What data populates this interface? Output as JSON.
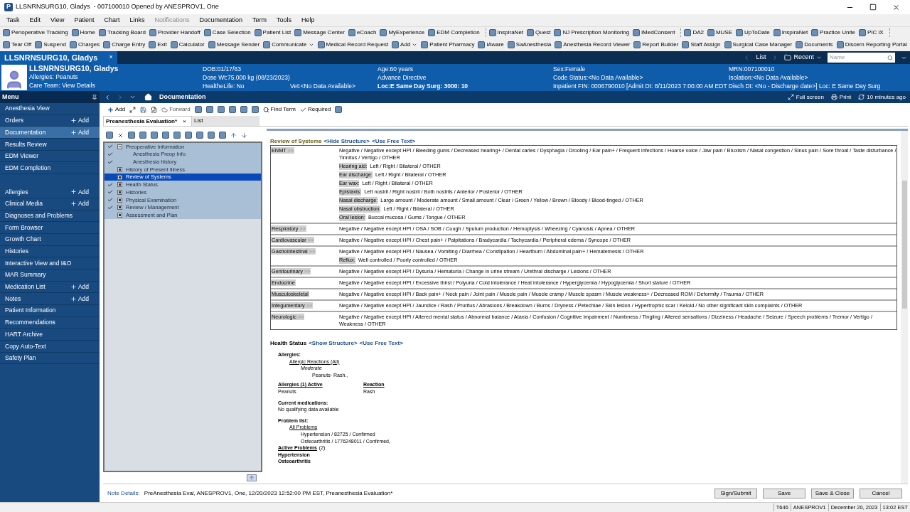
{
  "window": {
    "app_letter": "P",
    "title": "LLSNRNSURG10, Gladys  - 007100010 Opened by ANESPROV1, One"
  },
  "menubar": [
    {
      "label": "Task",
      "disabled": false
    },
    {
      "label": "Edit",
      "disabled": false
    },
    {
      "label": "View",
      "disabled": false
    },
    {
      "label": "Patient",
      "disabled": false
    },
    {
      "label": "Chart",
      "disabled": false
    },
    {
      "label": "Links",
      "disabled": false
    },
    {
      "label": "Notifications",
      "disabled": true
    },
    {
      "label": "Documentation",
      "disabled": false
    },
    {
      "label": "Term",
      "disabled": false
    },
    {
      "label": "Tools",
      "disabled": false
    },
    {
      "label": "Help",
      "disabled": false
    }
  ],
  "toolbar_1": [
    [
      "Perioperative Tracking",
      "Home",
      "Tracking Board",
      "Provider Handoff",
      "Case Selection",
      "Patient List",
      "Message Center",
      "eCoach",
      "MyExperience",
      "EDM Completion"
    ],
    [
      "InspiraNet",
      "Quest",
      "NJ Prescription Monitoring",
      "iMedConsent"
    ],
    [
      "DA2",
      "MUSE",
      "UpToDate",
      "InspiraNet",
      "Practice Unite",
      "PIC iX"
    ]
  ],
  "toolbar_2": [
    {
      "label": "Tear Off",
      "dropdown": false
    },
    {
      "label": "Suspend",
      "dropdown": false
    },
    {
      "label": "Charges",
      "dropdown": false
    },
    {
      "label": "Charge Entry",
      "dropdown": false
    },
    {
      "label": "Exit",
      "dropdown": false
    },
    {
      "label": "Calculator",
      "dropdown": false
    },
    {
      "label": "Message Sender",
      "dropdown": false
    },
    {
      "label": "Communicate",
      "dropdown": true
    },
    {
      "label": "Medical Record Request",
      "dropdown": false
    },
    {
      "label": "Add",
      "dropdown": true
    },
    {
      "label": "Patient Pharmacy",
      "dropdown": false
    },
    {
      "label": "iAware",
      "dropdown": false
    },
    {
      "label": "SaAnesthesia",
      "dropdown": false
    },
    {
      "label": "Anesthesia Record Viewer",
      "dropdown": false
    },
    {
      "label": "Report Builder",
      "dropdown": false
    },
    {
      "label": "Staff Assign",
      "dropdown": false
    },
    {
      "label": "Surgical Case Manager",
      "dropdown": false
    },
    {
      "label": "Documents",
      "dropdown": false
    },
    {
      "label": "Discern Reporting Portal",
      "dropdown": false
    }
  ],
  "patient_tab": {
    "label": "LLSNRNSURG10, Gladys",
    "close": "×"
  },
  "patient_nav": {
    "list": "List",
    "recent": "Recent",
    "search_placeholder": "Name"
  },
  "banner": {
    "name": "LLSNRNSURG10, Gladys",
    "allergies": "Allergies: Peanuts",
    "care_team": "Care Team: View Details",
    "dob": "DOB:01/17/63",
    "dose_wt": "Dose Wt:75.000 kg (08/23/2023)",
    "healthelife": "HealtheLife: No",
    "vet": "Vet:<No Data Available>",
    "age": "Age:60 years",
    "advance_directive": "Advance Directive",
    "loc": "Loc:E Same Day Surg: 3000: 10",
    "sex": "Sex:Female",
    "code_status": "Code Status:<No Data Available>",
    "fin": "Inpatient FIN: 0006790010 [Admit Dt: 8/11/2023 7:00:00 AM EDT Disch Dt: <No - Discharge date>] Loc: E Same Day Surg",
    "mrn": "MRN:007100010",
    "isolation": "Isolation:<No Data Available>"
  },
  "menu_bar": {
    "menu": "Menu",
    "page_title": "Documentation",
    "full_screen": "Full screen",
    "print": "Print",
    "refreshed": "10 minutes ago"
  },
  "sidebar": [
    [
      {
        "label": "Anesthesia View",
        "selected": false
      },
      {
        "label": "Orders",
        "add": "Add",
        "selected": false
      },
      {
        "label": "Documentation",
        "add": "Add",
        "selected": true
      },
      {
        "label": "Results Review",
        "selected": false
      },
      {
        "label": "EDM Viewer",
        "selected": false
      },
      {
        "label": "EDM Completion",
        "selected": false
      }
    ],
    [
      {
        "label": "Allergies",
        "add": "Add",
        "selected": false
      },
      {
        "label": "Clinical Media",
        "add": "Add",
        "selected": false
      },
      {
        "label": "Diagnoses and Problems",
        "selected": false
      },
      {
        "label": "Form Browser",
        "selected": false
      },
      {
        "label": "Growth Chart",
        "selected": false
      },
      {
        "label": "Histories",
        "selected": false
      },
      {
        "label": "Interactive View and I&O",
        "selected": false
      },
      {
        "label": "MAR Summary",
        "selected": false
      },
      {
        "label": "Medication List",
        "add": "Add",
        "selected": false
      },
      {
        "label": "Notes",
        "add": "Add",
        "selected": false
      },
      {
        "label": "Patient Information",
        "selected": false
      },
      {
        "label": "Recommendations",
        "selected": false
      },
      {
        "label": "HART Archive",
        "selected": false
      },
      {
        "label": "Copy Auto-Text",
        "selected": false
      },
      {
        "label": "Safety Plan",
        "selected": false
      }
    ]
  ],
  "doc_toolbar": {
    "add": "Add",
    "forward": "Forward",
    "find_term": "Find Term",
    "required": "Required"
  },
  "doc_tabs": [
    {
      "label": "Preanesthesia Evaluation*",
      "selected": true,
      "close": "×"
    },
    {
      "label": "List",
      "selected": false
    }
  ],
  "tree": [
    {
      "label": "Preoperative Information",
      "checked": true,
      "selected": false,
      "expanded": true,
      "children": [
        {
          "label": "Anesthesia Preop Info",
          "checked": true,
          "selected": false
        },
        {
          "label": "Anesthesia history",
          "checked": true,
          "selected": false
        }
      ]
    },
    {
      "label": "History of Present Illness",
      "checked": false,
      "selected": false,
      "expanded": false
    },
    {
      "label": "Review of Systems",
      "checked": false,
      "selected": true,
      "expanded": false
    },
    {
      "label": "Health Status",
      "checked": true,
      "selected": false,
      "expanded": false
    },
    {
      "label": "Histories",
      "checked": true,
      "selected": false,
      "expanded": false
    },
    {
      "label": "Physical Examination",
      "checked": true,
      "selected": false,
      "expanded": false
    },
    {
      "label": "Review / Management",
      "checked": true,
      "selected": false,
      "expanded": false
    },
    {
      "label": "Assessment and Plan",
      "checked": false,
      "selected": false,
      "expanded": false
    }
  ],
  "ros": {
    "title": "Review of Systems",
    "links": [
      "<Hide Structure>",
      "<Use Free Text>"
    ],
    "rows": [
      {
        "label": "ENMT",
        "more": ">>",
        "options": "Negative / Negative except HPI / Bleeding gums / Decreased hearing+ / Dental caries / Dysphagia / Drooling / Ear pain+ / Frequent infections / Hoarse voice / Jaw pain / Bruxism / Nasal congestion / Sinus pain / Sore throat / Taste disturbance / Tinnitus / Vertigo / OTHER",
        "sub": [
          {
            "label": "Hearing aid:",
            "options": "Left / Right / Bilateral / OTHER"
          },
          {
            "label": "Ear discharge:",
            "options": "Left / Right / Bilateral / OTHER"
          },
          {
            "label": "Ear wax:",
            "options": "Left / Right / Bilateral / OTHER"
          },
          {
            "label": "Epistaxis:",
            "options": "Left nostril / Right nostril / Both nostrils / Anterior / Posterior / OTHER"
          },
          {
            "label": "Nasal discharge:",
            "options": "Large amount / Moderate amount / Small amount / Clear / Green / Yellow / Brown / Bloody / Blood-tinged / OTHER"
          },
          {
            "label": "Nasal obstruction:",
            "options": "Left / Right / Bilateral / OTHER"
          },
          {
            "label": "Oral lesion:",
            "options": "Buccal mucosa / Gums / Tongue / OTHER"
          }
        ]
      },
      {
        "label": "Respiratory",
        "more": ">>",
        "options": "Negative / Negative except HPI / OSA / SOB / Cough / Sputum production / Hemoptysis / Wheezing / Cyanosis / Apnea / OTHER"
      },
      {
        "label": "Cardiovascular",
        "more": ">>",
        "options": "Negative / Negative except HPI / Chest pain+ / Palpitations / Bradycardia / Tachycardia / Peripheral edema / Syncope / OTHER"
      },
      {
        "label": "Gastrointestinal",
        "more": ">>",
        "options": "Negative / Negative except HPI / Nausea / Vomiting / Diarrhea / Constipation / Heartburn / Abdominal pain+ / Hematemesis / OTHER",
        "sub": [
          {
            "label": "Reflux:",
            "options": "Well controlled / Poorly controlled / OTHER"
          }
        ]
      },
      {
        "label": "Genitourinary",
        "more": ">>",
        "options": "Negative / Negative except HPI / Dysuria / Hematuria / Change in urine stream / Urethral discharge / Lesions / OTHER"
      },
      {
        "label": "Endocrine",
        "options": "Negative / Negative except HPI / Excessive thirst / Polyuria / Cold intolerance / Heat intolerance / Hyperglycemia / Hypoglycemia / Short stature / OTHER"
      },
      {
        "label": "Musculoskeletal",
        "options": "Negative / Negative except HPI / Back pain+ / Neck pain / Joint pain / Muscle pain / Muscle cramp / Muscle spasm / Muscle weakness+ / Decreased ROM / Deformity / Trauma / OTHER"
      },
      {
        "label": "Integumentary",
        "more": ">>",
        "options": "Negative / Negative except HPI / Jaundice / Rash / Pruritus / Abrasions / Breakdown / Burns / Dryness / Petechiae / Skin lesion / Hypertrophic scar / Keloid / No other significant skin complaints / OTHER"
      },
      {
        "label": "Neurologic",
        "more": ">>",
        "options": "Negative / Negative except HPI / Altered mental status / Abnormal balance / Ataxia / Confusion / Cognitive impairment / Numbness / Tingling / Altered sensations / Dizziness / Headache / Seizure / Speech problems / Tremor / Vertigo / Weakness / OTHER"
      }
    ]
  },
  "health_status": {
    "title": "Health Status",
    "links": [
      "<Show Structure>",
      "<Use Free Text>"
    ],
    "items": [
      {
        "kind": "heading",
        "text": "Allergies:",
        "children": [
          {
            "kind": "underline",
            "text": "Allergic Reactions (All)",
            "children": [
              {
                "kind": "italic",
                "text": "Moderate",
                "children": [
                  {
                    "kind": "plain",
                    "text": "Peanuts- Rash.,"
                  }
                ]
              }
            ]
          }
        ]
      },
      {
        "kind": "table",
        "columns": [
          "Allergies (1) Active",
          "Reaction"
        ],
        "rows": [
          [
            "Peanuts",
            "Rash"
          ]
        ]
      },
      {
        "kind": "heading",
        "text": "Current medications:"
      },
      {
        "kind": "plain",
        "text": "No qualifying data available"
      },
      {
        "kind": "heading",
        "text": "Problem list:",
        "children": [
          {
            "kind": "underline",
            "text": "All Problems",
            "children": [
              {
                "kind": "plain",
                "text": "Hypertension / 82725 / Confirmed"
              },
              {
                "kind": "plain",
                "text": "Osteoarthritis / 1776248011 / Confirmed,"
              }
            ]
          }
        ]
      },
      {
        "kind": "counted",
        "text": "Active Problems",
        "count": "(2)"
      },
      {
        "kind": "bold",
        "text": "Hypertension"
      },
      {
        "kind": "bold",
        "text": "Osteoarthritis"
      }
    ]
  },
  "note_details": {
    "label": "Note Details:",
    "text": "PreAnesthesia Eval, ANESPROV1, One, 12/20/2023 12:52:00 PM EST, Preanesthesia Evaluation*"
  },
  "buttons": [
    "Sign/Submit",
    "Save",
    "Save & Close",
    "Cancel"
  ],
  "status_bar": [
    "T646",
    "ANESPROV1",
    "December 20, 2023",
    "13:02 EST"
  ]
}
